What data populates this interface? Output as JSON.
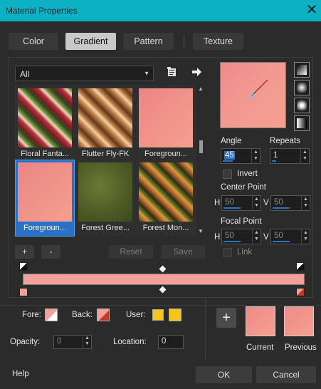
{
  "window": {
    "title": "Material Properties",
    "close_glyph": "✕"
  },
  "tabs": [
    {
      "label": "Color",
      "active": false
    },
    {
      "label": "Gradient",
      "active": true
    },
    {
      "label": "Pattern",
      "active": false
    },
    {
      "label": "Texture",
      "active": false
    }
  ],
  "category_select": {
    "value": "All"
  },
  "swatches": [
    {
      "label": "Floral Fanta...",
      "selected": false
    },
    {
      "label": "Flutter Fly-FK",
      "selected": false
    },
    {
      "label": "Foregroun...",
      "selected": false
    },
    {
      "label": "Foregroun...",
      "selected": true
    },
    {
      "label": "Forest Gree...",
      "selected": false
    },
    {
      "label": "Forest Mon...",
      "selected": false
    }
  ],
  "list_buttons": {
    "add": "+",
    "remove": "-",
    "reset": "Reset",
    "save": "Save"
  },
  "angle": {
    "label": "Angle",
    "value": "45"
  },
  "repeats": {
    "label": "Repeats",
    "value": "1"
  },
  "invert": {
    "label": "Invert",
    "checked": false
  },
  "center_point": {
    "label": "Center Point",
    "h_label": "H",
    "h_value": "50",
    "v_label": "V",
    "v_value": "50"
  },
  "focal_point": {
    "label": "Focal Point",
    "h_label": "H",
    "h_value": "50",
    "v_label": "V",
    "v_value": "50"
  },
  "link": {
    "label": "Link",
    "checked": false
  },
  "bottom": {
    "fore_label": "Fore:",
    "back_label": "Back:",
    "user_label": "User:",
    "user_color": "#f5c518",
    "opacity_label": "Opacity:",
    "opacity_value": "0",
    "location_label": "Location:",
    "location_value": "0",
    "add_glyph": "+",
    "current_label": "Current",
    "previous_label": "Previous"
  },
  "footer": {
    "help": "Help",
    "ok": "OK",
    "cancel": "Cancel"
  },
  "colors": {
    "titlebar": "#0db1c4",
    "gradient_pink": "#f4a09a",
    "selection": "#2a72c8"
  }
}
